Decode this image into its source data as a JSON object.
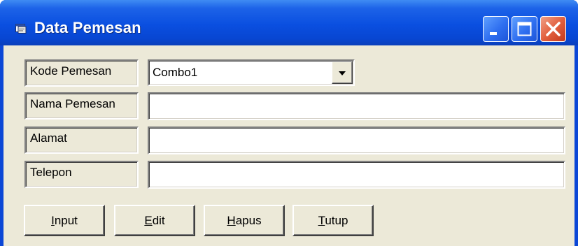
{
  "window": {
    "title": "Data Pemesan",
    "colors": {
      "titlebar": "#0a4fe0",
      "client": "#ece9d8",
      "close_button": "#e2603f"
    }
  },
  "form": {
    "fields": [
      {
        "label": "Kode Pemesan",
        "type": "combobox",
        "value": "Combo1"
      },
      {
        "label": "Nama Pemesan",
        "type": "textbox",
        "value": ""
      },
      {
        "label": "Alamat",
        "type": "textbox",
        "value": ""
      },
      {
        "label": "Telepon",
        "type": "textbox",
        "value": ""
      }
    ]
  },
  "buttons": [
    {
      "label": "Input",
      "accel": "I",
      "rest": "nput"
    },
    {
      "label": "Edit",
      "accel": "E",
      "rest": "dit"
    },
    {
      "label": "Hapus",
      "accel": "H",
      "rest": "apus"
    },
    {
      "label": "Tutup",
      "accel": "T",
      "rest": "utup"
    }
  ],
  "icons": {
    "app": "form-window-icon",
    "minimize": "minimize-icon",
    "maximize": "maximize-icon",
    "close": "close-icon",
    "dropdown": "chevron-down-icon"
  }
}
